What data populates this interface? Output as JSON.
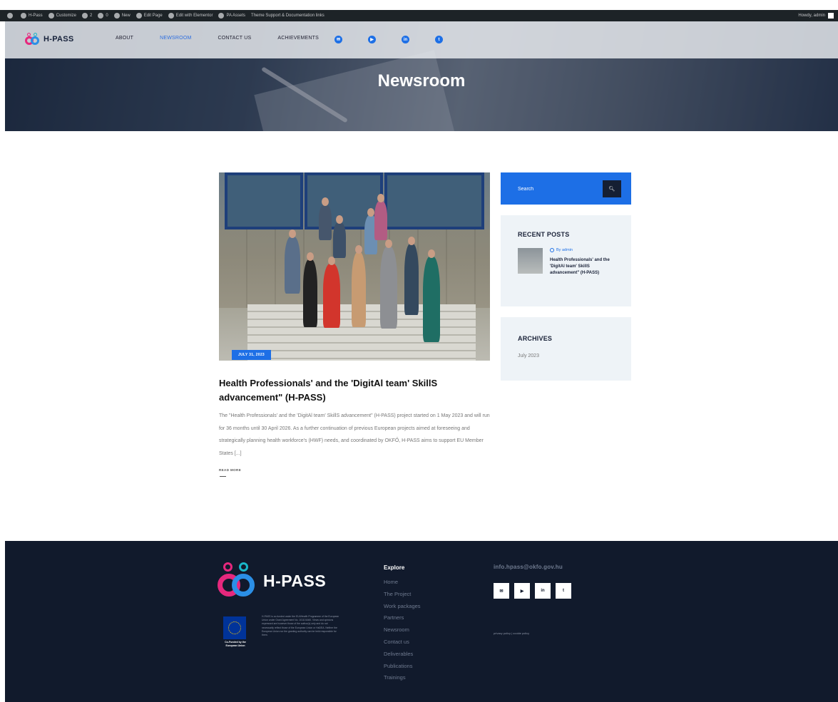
{
  "adminbar": {
    "site": "H-Pass",
    "customize": "Customize",
    "updates": "2",
    "comments": "0",
    "new": "New",
    "edit_page": "Edit Page",
    "edit_elementor": "Edit with Elementor",
    "pa_assets": "PA Assets",
    "theme_support": "Theme Support & Documentation links",
    "howdy": "Howdy, admin"
  },
  "header": {
    "logo_text": "H-PASS",
    "nav": [
      "ABOUT",
      "NEWSROOM",
      "CONTACT US",
      "ACHIEVEMENTS"
    ],
    "active_nav": "NEWSROOM",
    "social_icons": [
      "email-icon",
      "youtube-icon",
      "linkedin-icon",
      "twitter-icon"
    ],
    "hero_title": "Newsroom"
  },
  "post": {
    "date": "JULY 31, 2023",
    "title": "Health Professionals' and the 'DigitAl team' SkillS advancement\" (H-PASS)",
    "excerpt": "The \"Health Professionals' and the 'DigitAl team' SkillS advancement\" (H-PASS) project started on 1 May 2023 and will run for 36 months until 30 April 2026.  As a further continuation of previous European projects aimed at foreseeing and strategically planning health workforce's (HWF) needs, and coordinated by OKFŐ, H-PASS aims to support EU Member States [...]",
    "read_more": "READ MORE"
  },
  "sidebar": {
    "search_placeholder": "Search",
    "recent_title": "RECENT POSTS",
    "recent_author": "By admin",
    "recent_post_title": "Health Professionals' and the 'DigitAl team' SkillS advancement\" (H-PASS)",
    "archives_title": "ARCHIVES",
    "archive_item": "July 2023"
  },
  "footer": {
    "logo_text": "H-PASS",
    "eu_caption": "Co-Funded by the European Union",
    "eu_text": "H-PASS is co-funded under the EU4Health Programme of the European Union under Grant Agreement No. 101101660. Views and opinions expressed are however those of the author(s) only and do not necessarily reflect those of the European Union or HaDEA. Neither the European Union nor the granting authority can be held responsible for them.",
    "explore_title": "Explore",
    "links": [
      "Home",
      "The Project",
      "Work packages",
      "Partners",
      "Newsroom",
      "Contact us",
      "Deliverables",
      "Publications",
      "Trainings"
    ],
    "email": "info.hpass@okfo.gov.hu",
    "social_icons": [
      "email-icon",
      "youtube-icon",
      "linkedin-icon",
      "twitter-icon"
    ],
    "policy": "privacy policy | cookie policy"
  },
  "colors": {
    "accent": "#1d6fe6",
    "footer_bg": "#111a2c",
    "logo_pink": "#e6287d",
    "logo_blue": "#2b8fe6",
    "logo_teal": "#19b6c8"
  }
}
